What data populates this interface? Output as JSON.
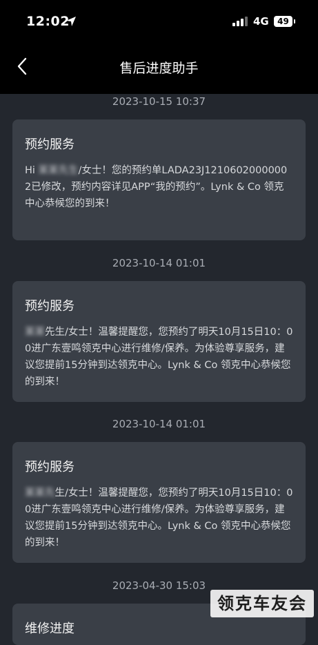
{
  "status_bar": {
    "time": "12:02",
    "network": "4G",
    "battery": "49"
  },
  "nav": {
    "title": "售后进度助手"
  },
  "messages": [
    {
      "timestamp": "2023-10-15 10:37",
      "title": "预约服务",
      "body_prefix": "Hi ",
      "body_redacted": "某某先生",
      "body": "/女士！您的预约单LADA23J12106020000002已修改，预约内容详见APP“我的预约”。Lynk & Co 领克中心恭候您的到来！"
    },
    {
      "timestamp": "2023-10-14 01:01",
      "title": "预约服务",
      "body_prefix": "",
      "body_redacted": "某某",
      "body": "先生/女士！温馨提醒您，您预约了明天10月15日10：00进广东壹鸣领克中心进行维修/保养。为体验尊享服务，建议您提前15分钟到达领克中心。Lynk & Co 领克中心恭候您的到来！"
    },
    {
      "timestamp": "2023-10-14 01:01",
      "title": "预约服务",
      "body_prefix": "",
      "body_redacted": "某某先",
      "body": "生/女士！温馨提醒您，您预约了明天10月15日10：00进广东壹鸣领克中心进行维修/保养。为体验尊享服务，建议您提前15分钟到达领克中心。Lynk & Co 领克中心恭候您的到来！"
    },
    {
      "timestamp": "2023-04-30 15:03",
      "title": "维修进度"
    }
  ],
  "watermark": "领克车友会"
}
